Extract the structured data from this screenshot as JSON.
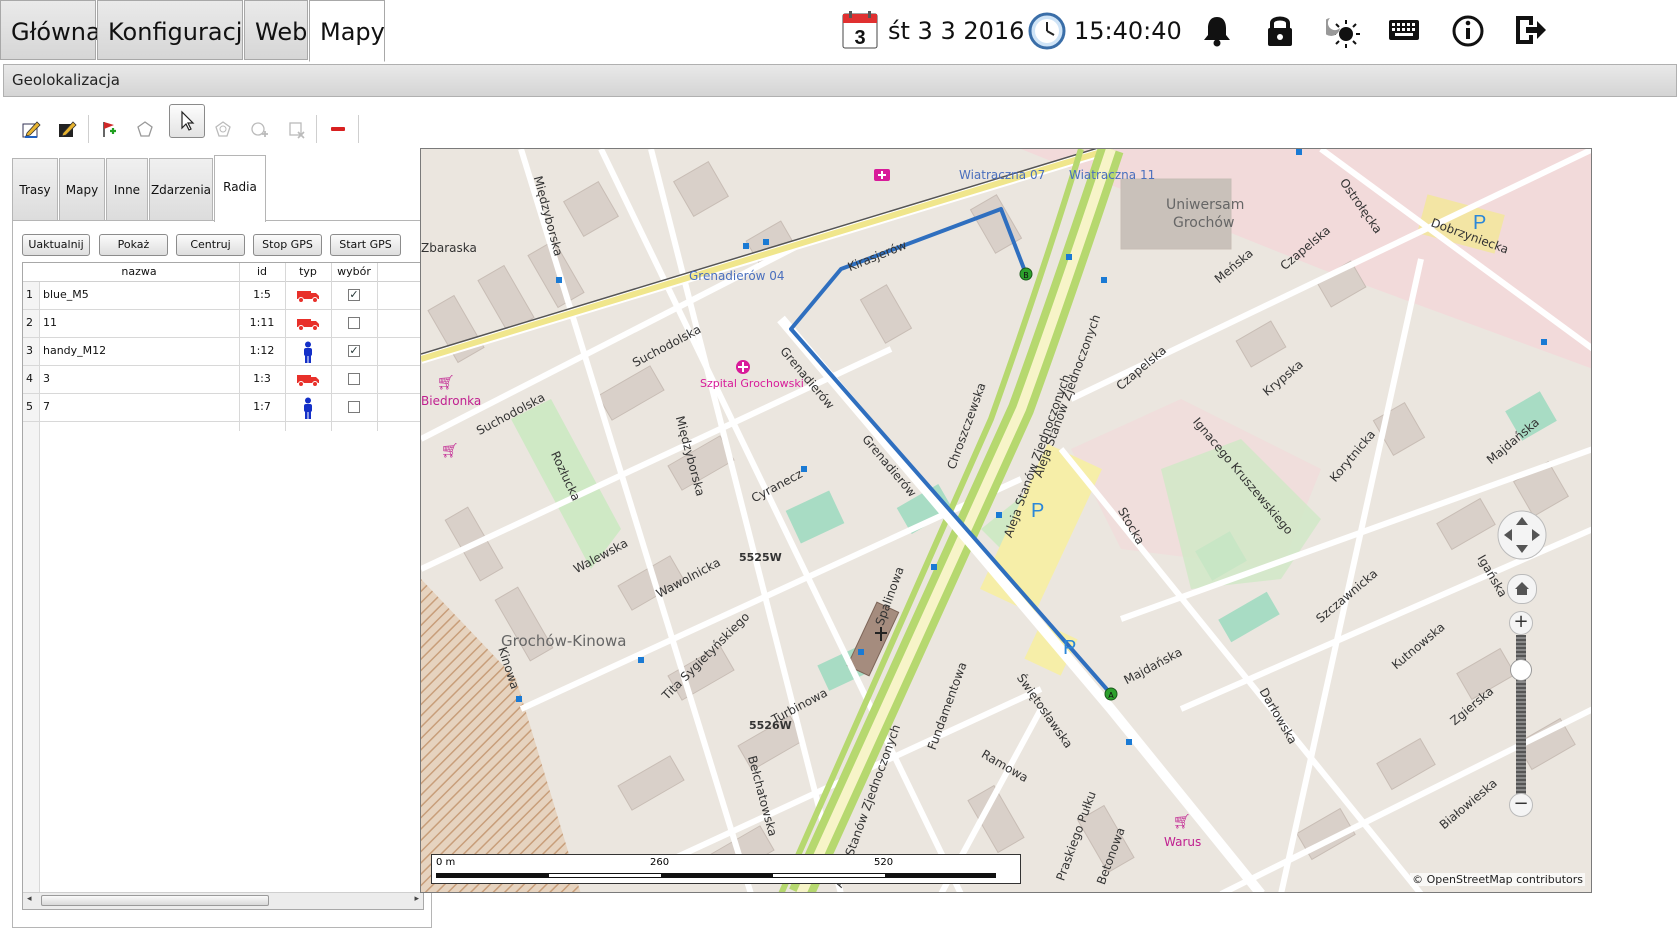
{
  "top_tabs": [
    "Główna",
    "Konfiguracja",
    "Web",
    "Mapy"
  ],
  "active_top_tab": "Mapy",
  "status": {
    "calendar_day": "3",
    "date": "śt 3 3 2016",
    "time": "15:40:40"
  },
  "status_icons": [
    "bell-icon",
    "lock-icon",
    "brightness-icon",
    "keyboard-icon",
    "info-icon",
    "logout-icon"
  ],
  "section_title": "Geolokalizacja",
  "toolbar_icons": [
    "edit-icon",
    "edit-route-icon",
    "flag-add-icon",
    "polygon-icon",
    "select-arrow-icon",
    "circle-polygon-icon",
    "add-shape-icon",
    "delete-shape-icon",
    "remove-icon"
  ],
  "panel_tabs": [
    "Trasy",
    "Mapy",
    "Inne",
    "Zdarzenia",
    "Radia"
  ],
  "active_panel_tab": "Radia",
  "panel_buttons": [
    "Uaktualnij",
    "Pokaż",
    "Centruj",
    "Stop GPS",
    "Start GPS"
  ],
  "table": {
    "headers": [
      "nazwa",
      "id",
      "typ",
      "wybór"
    ],
    "rows": [
      {
        "num": "1",
        "nazwa": "blue_M5",
        "id": "1:5",
        "typ": "truck",
        "wybor": true
      },
      {
        "num": "2",
        "nazwa": "11",
        "id": "1:11",
        "typ": "truck",
        "wybor": false
      },
      {
        "num": "3",
        "nazwa": "handy_M12",
        "id": "1:12",
        "typ": "person",
        "wybor": true
      },
      {
        "num": "4",
        "nazwa": "3",
        "id": "1:3",
        "typ": "truck",
        "wybor": false
      },
      {
        "num": "5",
        "nazwa": "7",
        "id": "1:7",
        "typ": "person",
        "wybor": false
      }
    ]
  },
  "map": {
    "labels": {
      "wiatraczna07": "Wiatraczna 07",
      "wiatraczna11": "Wiatraczna 11",
      "uniwersam": "Uniwersam",
      "grochow": "Grochów",
      "grenadierow04": "Grenadierów 04",
      "szpital": "Szpital Grochowski",
      "biedronka": "Biedronka",
      "grochow_kinowa": "Grochów-Kinowa",
      "zbaraska": "Zbaraska",
      "suchodolska": "Suchodolska",
      "suchodolska2": "Suchodolska",
      "walewska": "Walewska",
      "wawolnicka": "Wawolnicka",
      "cyranecz": "Cyranecz",
      "code1": "5525W",
      "code2": "5526W",
      "kinowa": "Kinowa",
      "turbinowa": "Turbinowa",
      "spalinowa": "Spalinowa",
      "chroszczewska": "Chroszczewska",
      "aleja": "Aleja Stanów Zjednoczonych",
      "aleja2": "Aleja Stanów Zjednoczonych",
      "aleja3": "Aleja Stanów Zjednoczonych",
      "majdanska": "Majdańska",
      "majdanska2": "Majdańska",
      "stocka": "Stocka",
      "kruszewskiego": "Ignacego Kruszewskiego",
      "korytnicka": "Korytnicka",
      "krypska": "Krypska",
      "czaplska": "Czapelska",
      "czapelska2": "Czapelska",
      "ostroleka": "Ostrołęcka",
      "dobrzyniecka": "Dobrzyniecka",
      "szczawnicka": "Szczawnicka",
      "kutnowska": "Kutnowska",
      "zgierska": "Zgierska",
      "ramowa": "Ramowa",
      "swietoslawska": "Świętosławska",
      "fundamentowa": "Fundamentowa",
      "warus": "Warus",
      "bialowieska": "Białowieska",
      "darlowska": "Darłowska",
      "miedzyborska": "Międzyborska",
      "miedzyborska2": "Międzyborska",
      "rozlucka": "Rozłucka",
      "sygietynskiego": "Tita Sygietyńskiego",
      "igancka": "Igańska",
      "mlodziencza": "Meńska",
      "praskiego": "Praskiego Pułku",
      "betonowa": "Betonowa",
      "grenadierow": "Grenadierów",
      "grenadierow2": "Grenadierów",
      "kirasjerow": "Kirasjerów",
      "belchatowska": "Bełchatowska"
    },
    "scale": [
      "0 m",
      "260",
      "520"
    ],
    "attribution": "© OpenStreetMap contributors",
    "marker_start": "A",
    "marker_end": "B",
    "route_color": "#2f6fbf"
  }
}
